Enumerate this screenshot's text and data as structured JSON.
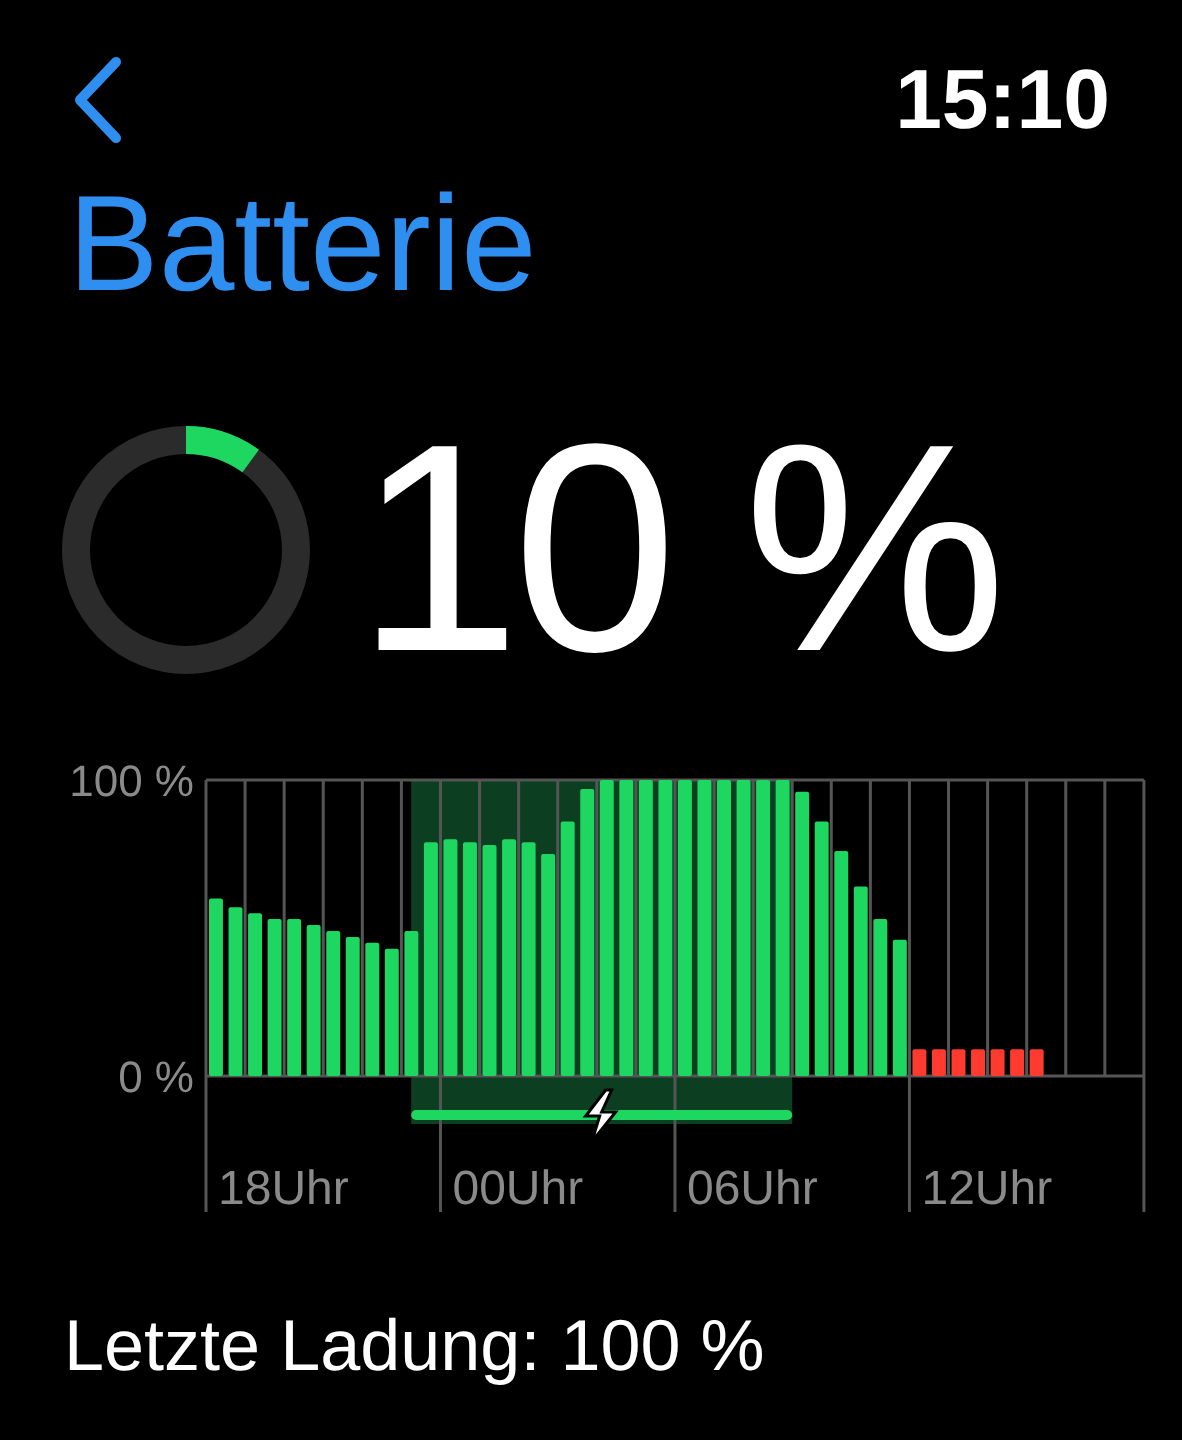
{
  "status_bar": {
    "time": "15:10"
  },
  "title": "Batterie",
  "battery": {
    "level": 0.1,
    "percent": "10 %"
  },
  "chart": {
    "time_labels": [
      "18Uhr",
      "00Uhr",
      "06Uhr",
      "12Uhr"
    ],
    "chart_data": {
      "type": "bar",
      "ylim": [
        0,
        100
      ],
      "yticks": [
        {
          "value": 0,
          "label": "0 %"
        },
        {
          "value": 100,
          "label": "100 %"
        }
      ],
      "series": [
        {
          "color": "#1ed760",
          "values": [
            60,
            57,
            55,
            53,
            53,
            51,
            49,
            47,
            45,
            43,
            49,
            79,
            80,
            79,
            78,
            80,
            79,
            75,
            86,
            97,
            100,
            100,
            100,
            100,
            100,
            100,
            100,
            100,
            100,
            100,
            96,
            86,
            76,
            64,
            53,
            46,
            null,
            null,
            null,
            null,
            null,
            null,
            null,
            null,
            null,
            null,
            null,
            null
          ]
        },
        {
          "color": "#ff3b30",
          "values": [
            null,
            null,
            null,
            null,
            null,
            null,
            null,
            null,
            null,
            null,
            null,
            null,
            null,
            null,
            null,
            null,
            null,
            null,
            null,
            null,
            null,
            null,
            null,
            null,
            null,
            null,
            null,
            null,
            null,
            null,
            null,
            null,
            null,
            null,
            null,
            null,
            9,
            9,
            9,
            9,
            9,
            9,
            9,
            null,
            null,
            null,
            null,
            null
          ]
        }
      ]
    }
  },
  "last_charge": "Letzte Ladung: 100 %"
}
